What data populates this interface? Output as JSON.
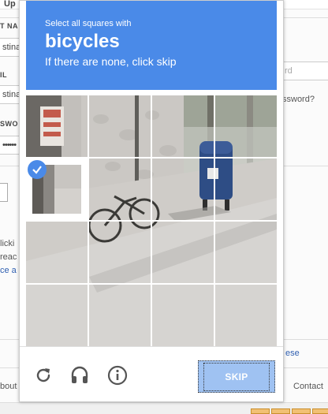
{
  "background": {
    "tab_label": "Up",
    "label_name": "T NA",
    "input_name_value": "stina",
    "label_email": "IL",
    "input_email_value": "stina",
    "label_password": "SWO",
    "input_password_value": "••••••",
    "placeholder_right": "rd",
    "forgot_link": "ssword?",
    "terms_1": "licki",
    "terms_2": "reac",
    "terms_3": "ce a",
    "right_link": "ese",
    "footer_left": "bout",
    "footer_right": "Contact"
  },
  "challenge": {
    "instruction_line": "Select all squares with",
    "keyword": "bicycles",
    "sub_instruction": "If there are none, click skip",
    "skip_label": "SKIP",
    "header_color": "#4a8ae8",
    "skip_color": "#9fc2f2"
  },
  "icons": [
    "reload-icon",
    "audio-icon",
    "info-icon",
    "checkmark-icon"
  ],
  "tiles": [
    {
      "row": 1,
      "col": 1,
      "selected": false
    },
    {
      "row": 1,
      "col": 2,
      "selected": false
    },
    {
      "row": 1,
      "col": 3,
      "selected": false
    },
    {
      "row": 1,
      "col": 4,
      "selected": false
    },
    {
      "row": 2,
      "col": 1,
      "selected": true
    },
    {
      "row": 2,
      "col": 2,
      "selected": false
    },
    {
      "row": 2,
      "col": 3,
      "selected": false
    },
    {
      "row": 2,
      "col": 4,
      "selected": false
    },
    {
      "row": 3,
      "col": 1,
      "selected": false
    },
    {
      "row": 3,
      "col": 2,
      "selected": false
    },
    {
      "row": 3,
      "col": 3,
      "selected": false
    },
    {
      "row": 3,
      "col": 4,
      "selected": false
    },
    {
      "row": 4,
      "col": 1,
      "selected": false
    },
    {
      "row": 4,
      "col": 2,
      "selected": false
    },
    {
      "row": 4,
      "col": 3,
      "selected": false
    },
    {
      "row": 4,
      "col": 4,
      "selected": false
    }
  ]
}
